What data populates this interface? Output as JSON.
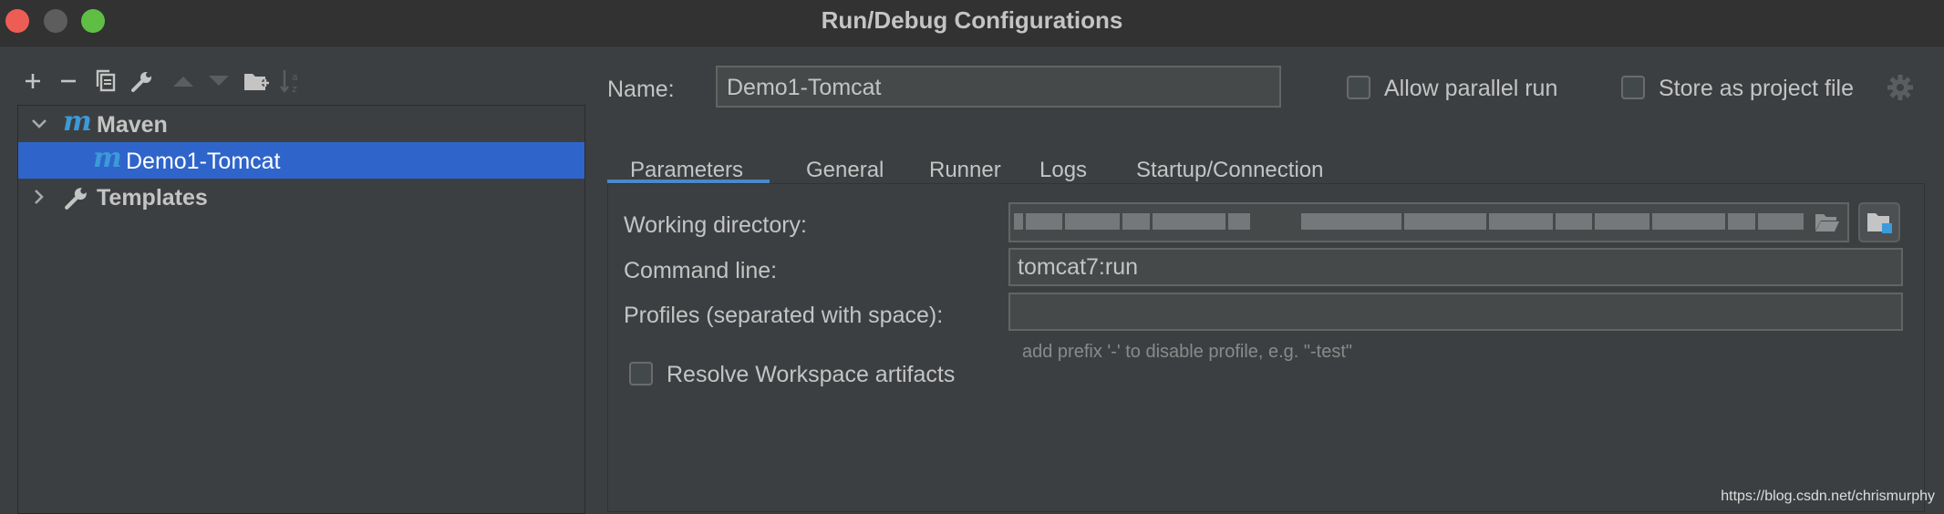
{
  "window": {
    "title": "Run/Debug Configurations"
  },
  "toolbar": {
    "buttons": [
      {
        "icon": "add-icon"
      },
      {
        "icon": "remove-icon"
      },
      {
        "icon": "copy-icon"
      },
      {
        "icon": "wrench-icon"
      },
      {
        "icon": "move-up-icon"
      },
      {
        "icon": "move-down-icon"
      },
      {
        "icon": "new-folder-icon"
      },
      {
        "icon": "sort-alpha-icon"
      }
    ]
  },
  "tree": {
    "items": [
      {
        "label": "Maven",
        "icon": "maven-icon",
        "expanded": true
      },
      {
        "label": "Demo1-Tomcat",
        "icon": "maven-icon",
        "selected": true
      },
      {
        "label": "Templates",
        "icon": "wrench-icon",
        "expanded": false
      }
    ]
  },
  "config": {
    "name_label": "Name:",
    "name_value": "Demo1-Tomcat",
    "allow_parallel_label": "Allow parallel run",
    "allow_parallel_checked": false,
    "store_project_label": "Store as project file",
    "store_project_checked": false
  },
  "tabs": [
    {
      "label": "Parameters",
      "active": true
    },
    {
      "label": "General",
      "active": false
    },
    {
      "label": "Runner",
      "active": false
    },
    {
      "label": "Logs",
      "active": false
    },
    {
      "label": "Startup/Connection",
      "active": false
    }
  ],
  "parameters": {
    "working_dir_label": "Working directory:",
    "command_line_label": "Command line:",
    "command_line_value": "tomcat7:run",
    "profiles_label": "Profiles (separated with space):",
    "profiles_value": "",
    "profiles_hint": "add prefix '-' to disable profile, e.g. \"-test\"",
    "resolve_label": "Resolve Workspace artifacts",
    "resolve_checked": false
  },
  "colors": {
    "background": "#3c3f41",
    "selection": "#2f65ca",
    "tab_accent": "#4a88c7",
    "maven_blue": "#3b9ad9"
  },
  "watermark": "https://blog.csdn.net/chrismurphy"
}
